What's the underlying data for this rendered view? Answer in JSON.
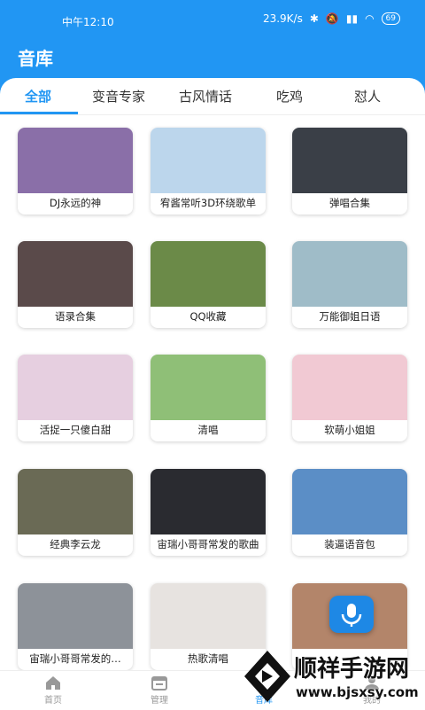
{
  "status": {
    "time": "中午12:10",
    "speed": "23.9K/s",
    "battery": "69"
  },
  "app": {
    "title": "音库"
  },
  "tabs": [
    {
      "label": "全部"
    },
    {
      "label": "变音专家"
    },
    {
      "label": "古风情话"
    },
    {
      "label": "吃鸡"
    },
    {
      "label": "怼人"
    }
  ],
  "cards": [
    {
      "label": "DJ永远的神",
      "color": "#8a6fa8"
    },
    {
      "label": "宥酱常听3D环绕歌单",
      "color": "#bcd6ec"
    },
    {
      "label": "弹唱合集",
      "color": "#3a3f47"
    },
    {
      "label": "语录合集",
      "color": "#5a4a4a"
    },
    {
      "label": "QQ收藏",
      "color": "#6b8a48"
    },
    {
      "label": "万能御姐日语",
      "color": "#9fbcc8"
    },
    {
      "label": "活捉一只傻白甜",
      "color": "#e6cfe0"
    },
    {
      "label": "清唱",
      "color": "#8fbf77"
    },
    {
      "label": "软萌小姐姐",
      "color": "#f1c9d3"
    },
    {
      "label": "经典李云龙",
      "color": "#6a6a55"
    },
    {
      "label": "宙瑞小哥哥常发的歌曲",
      "color": "#2a2b30"
    },
    {
      "label": "装逼语音包",
      "color": "#5b8ec6"
    },
    {
      "label": "宙瑞小哥哥常发的…",
      "color": "#8d9299"
    },
    {
      "label": "热歌清唱",
      "color": "#e7e3e0"
    },
    {
      "label": "",
      "color": "#b3856a"
    }
  ],
  "nav": [
    {
      "label": "首页"
    },
    {
      "label": "管理"
    },
    {
      "label": "音库"
    },
    {
      "label": "我的"
    }
  ],
  "watermark": {
    "brand": "顺祥手游网",
    "url": "www.bjsxsy.com"
  }
}
